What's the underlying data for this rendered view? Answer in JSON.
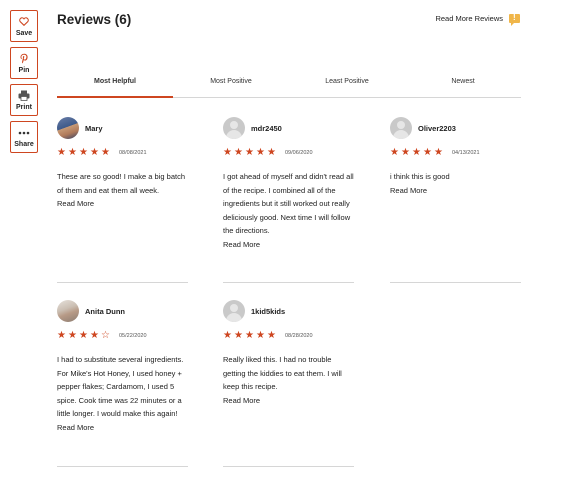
{
  "share_rail": {
    "save": "Save",
    "pin": "Pin",
    "print": "Print",
    "share": "Share"
  },
  "header": {
    "title": "Reviews (6)",
    "read_more_reviews": "Read More Reviews"
  },
  "tabs": [
    {
      "label": "Most Helpful",
      "active": true
    },
    {
      "label": "Most Positive",
      "active": false
    },
    {
      "label": "Least Positive",
      "active": false
    },
    {
      "label": "Newest",
      "active": false
    }
  ],
  "colors": {
    "accent": "#ce4620",
    "badge": "#f0b64a"
  },
  "reviews": [
    {
      "name": "Mary",
      "rating": 5,
      "date": "08/08/2021",
      "text": "These are so good! I make a big batch of them and eat them all week.",
      "read_more": "Read More"
    },
    {
      "name": "mdr2450",
      "rating": 5,
      "date": "09/06/2020",
      "text": "I got ahead of myself and didn't read all of the recipe. I combined all of the ingredients but it still worked out really deliciously good. Next time I will follow the directions.",
      "read_more": "Read More"
    },
    {
      "name": "Oliver2203",
      "rating": 5,
      "date": "04/13/2021",
      "text": "i think this is good",
      "read_more": "Read More"
    },
    {
      "name": "Anita Dunn",
      "rating": 4,
      "date": "05/22/2020",
      "text": "I had to substitute several ingredients. For Mike's Hot Honey, I used honey + pepper flakes; Cardamom, I used 5 spice. Cook time was 22 minutes or a little longer. I would make this again!",
      "read_more": "Read More"
    },
    {
      "name": "1kid5kids",
      "rating": 5,
      "date": "08/28/2020",
      "text": "Really liked this. I had no trouble getting the kiddies to eat them. I will keep this recipe.",
      "read_more": "Read More"
    }
  ]
}
